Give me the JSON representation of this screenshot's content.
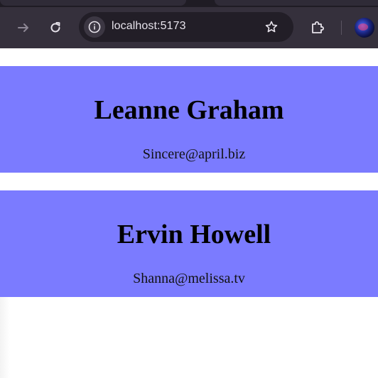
{
  "browser": {
    "url": "localhost:5173",
    "icons": {
      "forward": "forward-arrow-icon",
      "reload": "reload-icon",
      "site_info": "info-icon",
      "bookmark": "star-icon",
      "extensions": "puzzle-icon",
      "profile": "avatar"
    },
    "colors": {
      "toolbar": "#35303c",
      "omnibox": "#221e27"
    }
  },
  "users": [
    {
      "name": "Leanne Graham",
      "email": "Sincere@april.biz"
    },
    {
      "name": "Ervin Howell",
      "email": "Shanna@melissa.tv"
    }
  ],
  "colors": {
    "card_background": "#7b7bff",
    "page_background": "#ffffff"
  }
}
